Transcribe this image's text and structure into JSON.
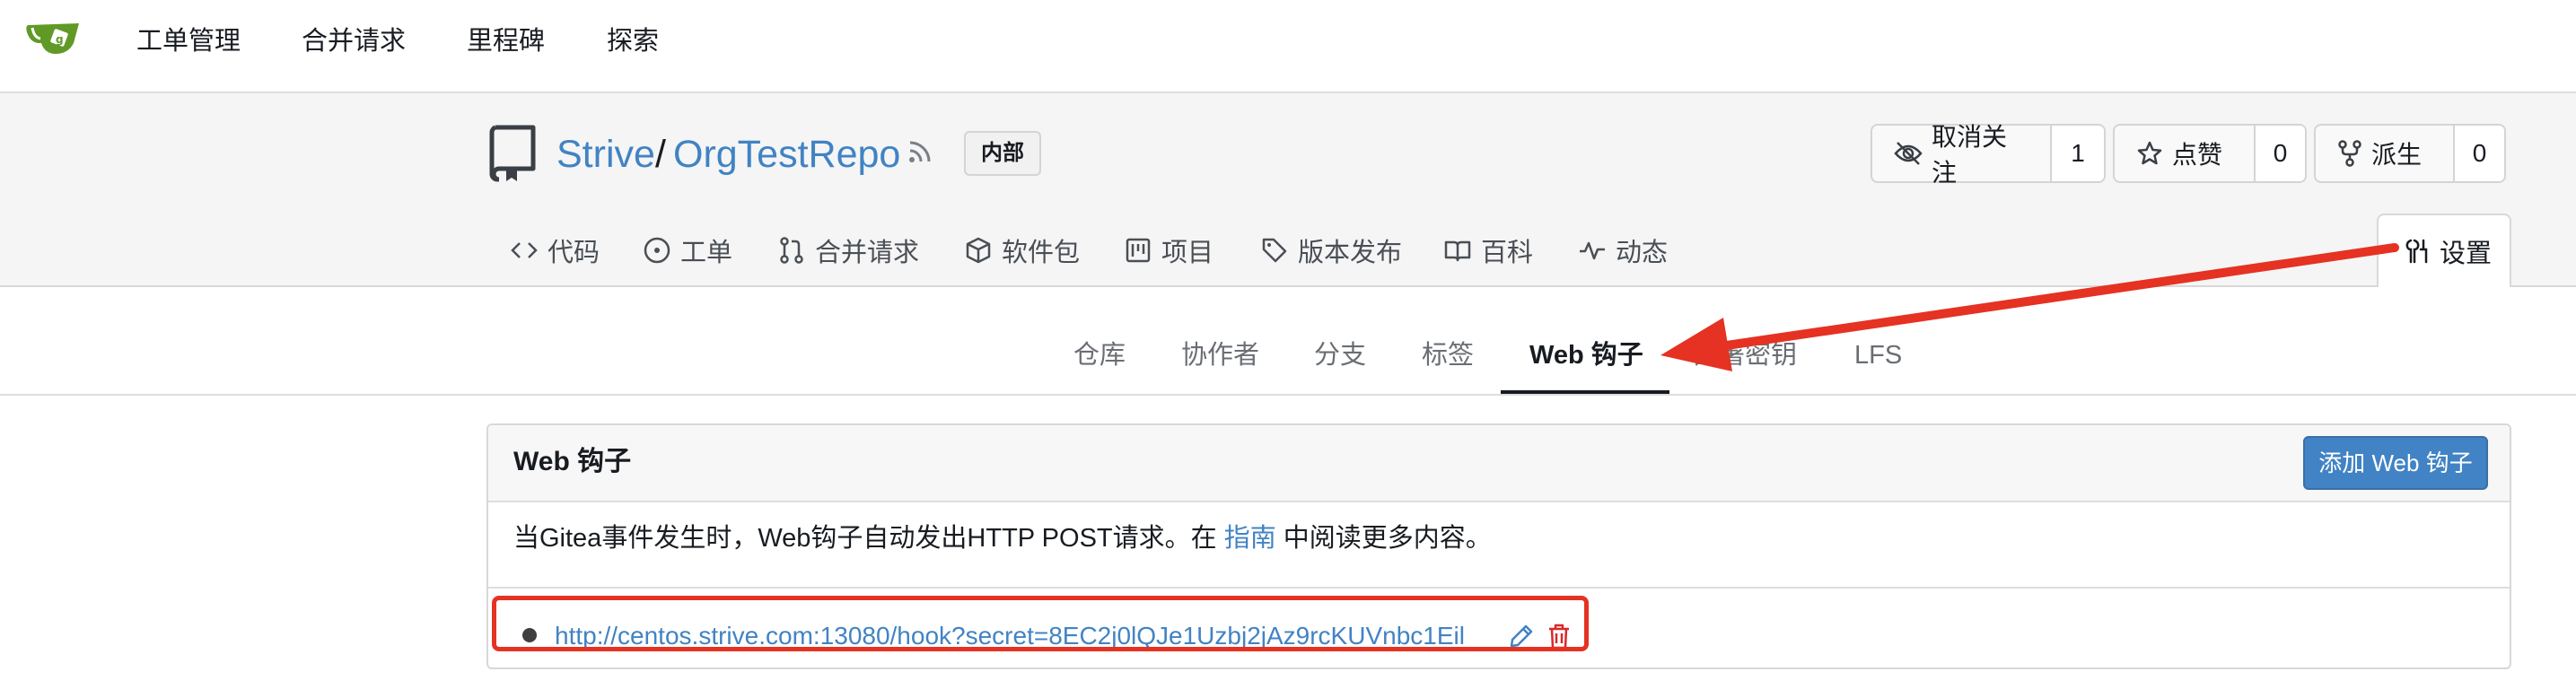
{
  "nav": {
    "items": [
      "工单管理",
      "合并请求",
      "里程碑",
      "探索"
    ]
  },
  "repo": {
    "owner": "Strive",
    "separator": "/",
    "name": "OrgTestRepo",
    "visibility_badge": "内部",
    "watch": {
      "label": "取消关注",
      "count": "1",
      "icon": "eye-slash-icon"
    },
    "star": {
      "label": "点赞",
      "count": "0",
      "icon": "star-icon"
    },
    "fork": {
      "label": "派生",
      "count": "0",
      "icon": "fork-icon"
    }
  },
  "tabs": [
    {
      "label": "代码",
      "icon": "code-icon"
    },
    {
      "label": "工单",
      "icon": "issue-icon"
    },
    {
      "label": "合并请求",
      "icon": "pull-request-icon"
    },
    {
      "label": "软件包",
      "icon": "package-icon"
    },
    {
      "label": "项目",
      "icon": "project-icon"
    },
    {
      "label": "版本发布",
      "icon": "tag-icon"
    },
    {
      "label": "百科",
      "icon": "book-icon"
    },
    {
      "label": "动态",
      "icon": "pulse-icon"
    }
  ],
  "settings_tab": {
    "label": "设置",
    "icon": "tools-icon"
  },
  "settings_menu": {
    "items": [
      "仓库",
      "协作者",
      "分支",
      "标签",
      "Web 钩子",
      "部署密钥",
      "LFS"
    ],
    "active": "Web 钩子"
  },
  "webhooks": {
    "title": "Web 钩子",
    "add_button": "添加 Web 钩子",
    "desc_before": "当Gitea事件发生时，Web钩子自动发出HTTP POST请求。在",
    "desc_link": "指南",
    "desc_after": "中阅读更多内容。",
    "hooks": [
      {
        "url": "http://centos.strive.com:13080/hook?secret=8EC2j0lQJe1Uzbj2jAz9rcKUVnbc1Eil"
      }
    ]
  },
  "colors": {
    "accent": "#4183c4",
    "annotation_red": "#e53222",
    "delete_red": "#db2828",
    "logo_green": "#609926"
  }
}
